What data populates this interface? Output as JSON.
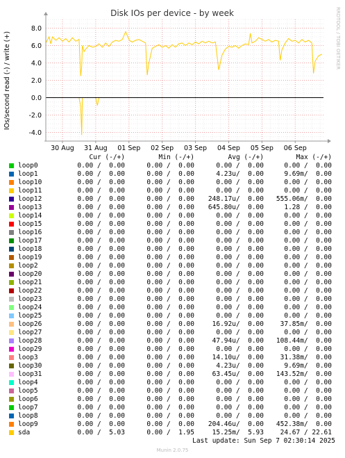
{
  "chart_data": {
    "type": "line",
    "title": "Disk IOs per device - by week",
    "ylabel": "IOs/second read (-) / write (+)",
    "ylim": [
      -5,
      9
    ],
    "yticks": [
      {
        "value": 8,
        "label": "8.0"
      },
      {
        "value": 6,
        "label": "6.0"
      },
      {
        "value": 4,
        "label": "4.0"
      },
      {
        "value": 2,
        "label": "2.0"
      },
      {
        "value": 0,
        "label": "0.0"
      },
      {
        "value": -2,
        "label": "-2.0"
      },
      {
        "value": -4,
        "label": "-4.0"
      }
    ],
    "xlim": [
      0,
      8.35
    ],
    "xticks": [
      {
        "value": 0.5,
        "label": "30 Aug"
      },
      {
        "value": 1.5,
        "label": "31 Aug"
      },
      {
        "value": 2.5,
        "label": "01 Sep"
      },
      {
        "value": 3.5,
        "label": "02 Sep"
      },
      {
        "value": 4.5,
        "label": "03 Sep"
      },
      {
        "value": 5.5,
        "label": "04 Sep"
      },
      {
        "value": 6.5,
        "label": "05 Sep"
      },
      {
        "value": 7.5,
        "label": "06 Sep"
      }
    ],
    "grid": true,
    "series": [
      {
        "name": "sda",
        "color": "#ffcc00",
        "x": [
          0.0,
          0.1,
          0.15,
          0.2,
          0.3,
          0.4,
          0.5,
          0.6,
          0.7,
          0.8,
          0.9,
          1.0,
          1.05,
          1.08,
          1.1,
          1.15,
          1.2,
          1.3,
          1.4,
          1.5,
          1.6,
          1.7,
          1.8,
          1.9,
          2.0,
          2.1,
          2.2,
          2.3,
          2.4,
          2.5,
          2.55,
          2.6,
          2.7,
          2.8,
          2.9,
          3.0,
          3.05,
          3.1,
          3.2,
          3.3,
          3.4,
          3.5,
          3.6,
          3.7,
          3.8,
          3.9,
          4.0,
          4.1,
          4.2,
          4.3,
          4.4,
          4.5,
          4.6,
          4.7,
          4.8,
          4.9,
          5.0,
          5.1,
          5.2,
          5.3,
          5.4,
          5.5,
          5.6,
          5.7,
          5.8,
          5.9,
          6.0,
          6.1,
          6.15,
          6.2,
          6.3,
          6.4,
          6.5,
          6.6,
          6.7,
          6.8,
          6.9,
          7.0,
          7.05,
          7.1,
          7.2,
          7.3,
          7.4,
          7.5,
          7.6,
          7.7,
          7.8,
          7.9,
          8.0,
          8.05,
          8.1,
          8.2,
          8.3
        ],
        "y": [
          6.3,
          7.0,
          6.2,
          7.0,
          6.6,
          6.9,
          6.5,
          6.8,
          6.4,
          6.9,
          6.5,
          6.7,
          2.5,
          3.6,
          6.0,
          5.3,
          5.6,
          6.0,
          5.8,
          5.9,
          6.2,
          5.8,
          6.3,
          5.9,
          6.4,
          6.6,
          6.5,
          6.7,
          7.6,
          6.7,
          6.5,
          6.4,
          6.6,
          6.7,
          6.5,
          6.3,
          2.6,
          4.0,
          5.7,
          5.9,
          6.1,
          5.8,
          6.0,
          5.7,
          6.1,
          5.8,
          6.2,
          6.3,
          6.0,
          6.3,
          6.1,
          6.4,
          6.2,
          6.5,
          6.3,
          6.5,
          6.3,
          6.4,
          3.2,
          4.9,
          5.6,
          5.9,
          5.8,
          6.0,
          5.7,
          6.0,
          6.2,
          6.1,
          7.4,
          6.3,
          6.5,
          6.9,
          6.7,
          6.5,
          6.7,
          6.4,
          6.6,
          6.5,
          4.3,
          5.5,
          6.3,
          6.8,
          6.5,
          6.6,
          6.3,
          6.7,
          6.4,
          6.6,
          6.3,
          2.8,
          4.2,
          4.8,
          5.0
        ]
      },
      {
        "name": "sda (read)",
        "color": "#ffcc00",
        "x": [
          0.0,
          1.0,
          1.05,
          1.08,
          1.1,
          1.5,
          1.55,
          1.6,
          2.0,
          8.35
        ],
        "y": [
          0.0,
          0.0,
          -1.0,
          -4.3,
          0.0,
          0.0,
          -0.9,
          0.0,
          0.0,
          0.0
        ]
      }
    ]
  },
  "watermark": "RRDTOOL / TOBI OETIKER",
  "legend": {
    "headers": {
      "cur": "Cur (-/+)",
      "min": "Min (-/+)",
      "avg": "Avg (-/+)",
      "max": "Max (-/+)"
    },
    "rows": [
      {
        "name": "loop0",
        "color": "#00cc00",
        "cur": "0.00 /  0.00",
        "min": "0.00 /  0.00",
        "avg": "0.00 /  0.00",
        "max": "0.00 /  0.00"
      },
      {
        "name": "loop1",
        "color": "#0066b3",
        "cur": "0.00 /  0.00",
        "min": "0.00 /  0.00",
        "avg": "4.23u/  0.00",
        "max": "9.69m/  0.00"
      },
      {
        "name": "loop10",
        "color": "#ff8000",
        "cur": "0.00 /  0.00",
        "min": "0.00 /  0.00",
        "avg": "0.00 /  0.00",
        "max": "0.00 /  0.00"
      },
      {
        "name": "loop11",
        "color": "#ffcc00",
        "cur": "0.00 /  0.00",
        "min": "0.00 /  0.00",
        "avg": "0.00 /  0.00",
        "max": "0.00 /  0.00"
      },
      {
        "name": "loop12",
        "color": "#330099",
        "cur": "0.00 /  0.00",
        "min": "0.00 /  0.00",
        "avg": "248.17u/  0.00",
        "max": "555.06m/  0.00"
      },
      {
        "name": "loop13",
        "color": "#990099",
        "cur": "0.00 /  0.00",
        "min": "0.00 /  0.00",
        "avg": "645.80u/  0.00",
        "max": "1.28 /  0.00"
      },
      {
        "name": "loop14",
        "color": "#ccff00",
        "cur": "0.00 /  0.00",
        "min": "0.00 /  0.00",
        "avg": "0.00 /  0.00",
        "max": "0.00 /  0.00"
      },
      {
        "name": "loop15",
        "color": "#ff0000",
        "cur": "0.00 /  0.00",
        "min": "0.00 /  0.00",
        "avg": "0.00 /  0.00",
        "max": "0.00 /  0.00"
      },
      {
        "name": "loop16",
        "color": "#808080",
        "cur": "0.00 /  0.00",
        "min": "0.00 /  0.00",
        "avg": "0.00 /  0.00",
        "max": "0.00 /  0.00"
      },
      {
        "name": "loop17",
        "color": "#008f00",
        "cur": "0.00 /  0.00",
        "min": "0.00 /  0.00",
        "avg": "0.00 /  0.00",
        "max": "0.00 /  0.00"
      },
      {
        "name": "loop18",
        "color": "#00487d",
        "cur": "0.00 /  0.00",
        "min": "0.00 /  0.00",
        "avg": "0.00 /  0.00",
        "max": "0.00 /  0.00"
      },
      {
        "name": "loop19",
        "color": "#b35a00",
        "cur": "0.00 /  0.00",
        "min": "0.00 /  0.00",
        "avg": "0.00 /  0.00",
        "max": "0.00 /  0.00"
      },
      {
        "name": "loop2",
        "color": "#b38f00",
        "cur": "0.00 /  0.00",
        "min": "0.00 /  0.00",
        "avg": "0.00 /  0.00",
        "max": "0.00 /  0.00"
      },
      {
        "name": "loop20",
        "color": "#6b006b",
        "cur": "0.00 /  0.00",
        "min": "0.00 /  0.00",
        "avg": "0.00 /  0.00",
        "max": "0.00 /  0.00"
      },
      {
        "name": "loop21",
        "color": "#8fb300",
        "cur": "0.00 /  0.00",
        "min": "0.00 /  0.00",
        "avg": "0.00 /  0.00",
        "max": "0.00 /  0.00"
      },
      {
        "name": "loop22",
        "color": "#b30000",
        "cur": "0.00 /  0.00",
        "min": "0.00 /  0.00",
        "avg": "0.00 /  0.00",
        "max": "0.00 /  0.00"
      },
      {
        "name": "loop23",
        "color": "#bebebe",
        "cur": "0.00 /  0.00",
        "min": "0.00 /  0.00",
        "avg": "0.00 /  0.00",
        "max": "0.00 /  0.00"
      },
      {
        "name": "loop24",
        "color": "#80ff80",
        "cur": "0.00 /  0.00",
        "min": "0.00 /  0.00",
        "avg": "0.00 /  0.00",
        "max": "0.00 /  0.00"
      },
      {
        "name": "loop25",
        "color": "#80c9ff",
        "cur": "0.00 /  0.00",
        "min": "0.00 /  0.00",
        "avg": "0.00 /  0.00",
        "max": "0.00 /  0.00"
      },
      {
        "name": "loop26",
        "color": "#ffc080",
        "cur": "0.00 /  0.00",
        "min": "0.00 /  0.00",
        "avg": "16.92u/  0.00",
        "max": "37.85m/  0.00"
      },
      {
        "name": "loop27",
        "color": "#ffe680",
        "cur": "0.00 /  0.00",
        "min": "0.00 /  0.00",
        "avg": "0.00 /  0.00",
        "max": "0.00 /  0.00"
      },
      {
        "name": "loop28",
        "color": "#aa80ff",
        "cur": "0.00 /  0.00",
        "min": "0.00 /  0.00",
        "avg": "47.94u/  0.00",
        "max": "108.44m/  0.00"
      },
      {
        "name": "loop29",
        "color": "#ee00cc",
        "cur": "0.00 /  0.00",
        "min": "0.00 /  0.00",
        "avg": "0.00 /  0.00",
        "max": "0.00 /  0.00"
      },
      {
        "name": "loop3",
        "color": "#ff8080",
        "cur": "0.00 /  0.00",
        "min": "0.00 /  0.00",
        "avg": "14.10u/  0.00",
        "max": "31.38m/  0.00"
      },
      {
        "name": "loop30",
        "color": "#666600",
        "cur": "0.00 /  0.00",
        "min": "0.00 /  0.00",
        "avg": "4.23u/  0.00",
        "max": "9.69m/  0.00"
      },
      {
        "name": "loop31",
        "color": "#ffbfff",
        "cur": "0.00 /  0.00",
        "min": "0.00 /  0.00",
        "avg": "63.45u/  0.00",
        "max": "143.52m/  0.00"
      },
      {
        "name": "loop4",
        "color": "#00ffcc",
        "cur": "0.00 /  0.00",
        "min": "0.00 /  0.00",
        "avg": "0.00 /  0.00",
        "max": "0.00 /  0.00"
      },
      {
        "name": "loop5",
        "color": "#cc6699",
        "cur": "0.00 /  0.00",
        "min": "0.00 /  0.00",
        "avg": "0.00 /  0.00",
        "max": "0.00 /  0.00"
      },
      {
        "name": "loop6",
        "color": "#999900",
        "cur": "0.00 /  0.00",
        "min": "0.00 /  0.00",
        "avg": "0.00 /  0.00",
        "max": "0.00 /  0.00"
      },
      {
        "name": "loop7",
        "color": "#00cc00",
        "cur": "0.00 /  0.00",
        "min": "0.00 /  0.00",
        "avg": "0.00 /  0.00",
        "max": "0.00 /  0.00"
      },
      {
        "name": "loop8",
        "color": "#0066b3",
        "cur": "0.00 /  0.00",
        "min": "0.00 /  0.00",
        "avg": "0.00 /  0.00",
        "max": "0.00 /  0.00"
      },
      {
        "name": "loop9",
        "color": "#ff8000",
        "cur": "0.00 /  0.00",
        "min": "0.00 /  0.00",
        "avg": "204.46u/  0.00",
        "max": "452.38m/  0.00"
      },
      {
        "name": "sda",
        "color": "#ffcc00",
        "cur": "0.00 /  5.03",
        "min": "0.00 /  1.95",
        "avg": "15.25m/  5.93",
        "max": "24.67 / 22.61"
      }
    ]
  },
  "footer": {
    "last_update": "Last update: Sun Sep  7 02:30:14 2025",
    "munin": "Munin 2.0.75"
  }
}
